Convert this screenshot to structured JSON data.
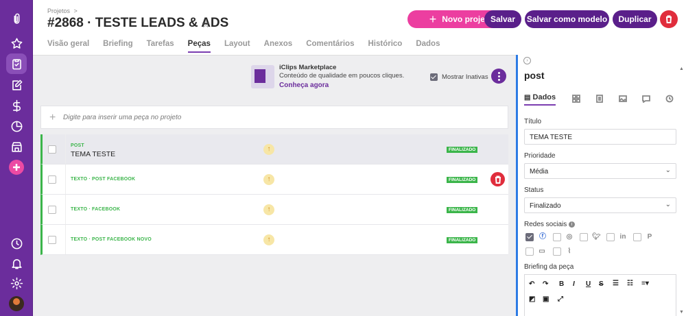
{
  "header": {
    "breadcrumb": "Projetos",
    "breadcrumb_sep": ">",
    "title": "#2868 · TESTE LEADS & ADS",
    "buttons": {
      "new_project": "Novo projeto",
      "save": "Salvar",
      "save_as_model": "Salvar como modelo",
      "duplicate": "Duplicar"
    },
    "tabs": [
      "Visão geral",
      "Briefing",
      "Tarefas",
      "Peças",
      "Layout",
      "Anexos",
      "Comentários",
      "Histórico",
      "Dados"
    ],
    "active_tab": "Peças"
  },
  "marketplace": {
    "title": "iClips Marketplace",
    "subtitle": "Conteúdo de qualidade em poucos cliques.",
    "link": "Conheça agora"
  },
  "show_inactive": {
    "label": "Mostrar Inativas",
    "checked": true
  },
  "insert_placeholder": "Digite para inserir uma peça no projeto",
  "pieces": [
    {
      "type": "POST",
      "name": "TEMA TESTE",
      "status": "FINALIZADO",
      "selected": true
    },
    {
      "type": "TEXTO · POST FACEBOOK",
      "name": "",
      "status": "FINALIZADO",
      "selected": false
    },
    {
      "type": "TEXTO · FACEBOOK",
      "name": "",
      "status": "FINALIZADO",
      "selected": false
    },
    {
      "type": "TEXTO · POST FACEBOOK NOVO",
      "name": "",
      "status": "FINALIZADO",
      "selected": false
    }
  ],
  "panel": {
    "title": "post",
    "tab_dados": "Dados",
    "titulo_label": "Título",
    "titulo_value": "TEMA TESTE",
    "prioridade_label": "Prioridade",
    "prioridade_value": "Média",
    "status_label": "Status",
    "status_value": "Finalizado",
    "redes_label": "Redes sociais",
    "briefing_label": "Briefing da peça",
    "social_networks": [
      {
        "name": "facebook-icon",
        "checked": true
      },
      {
        "name": "instagram-icon",
        "checked": false
      },
      {
        "name": "twitter-icon",
        "checked": false
      },
      {
        "name": "linkedin-icon",
        "checked": false
      },
      {
        "name": "pinterest-icon",
        "checked": false
      },
      {
        "name": "youtube-icon",
        "checked": false
      },
      {
        "name": "rss-icon",
        "checked": false
      }
    ]
  },
  "colors": {
    "sidebar": "#6b2d9c",
    "accent_pink": "#ec3ea0",
    "primary_purple": "#5a1f8a",
    "danger": "#e02d3c",
    "success": "#3bb54a"
  }
}
